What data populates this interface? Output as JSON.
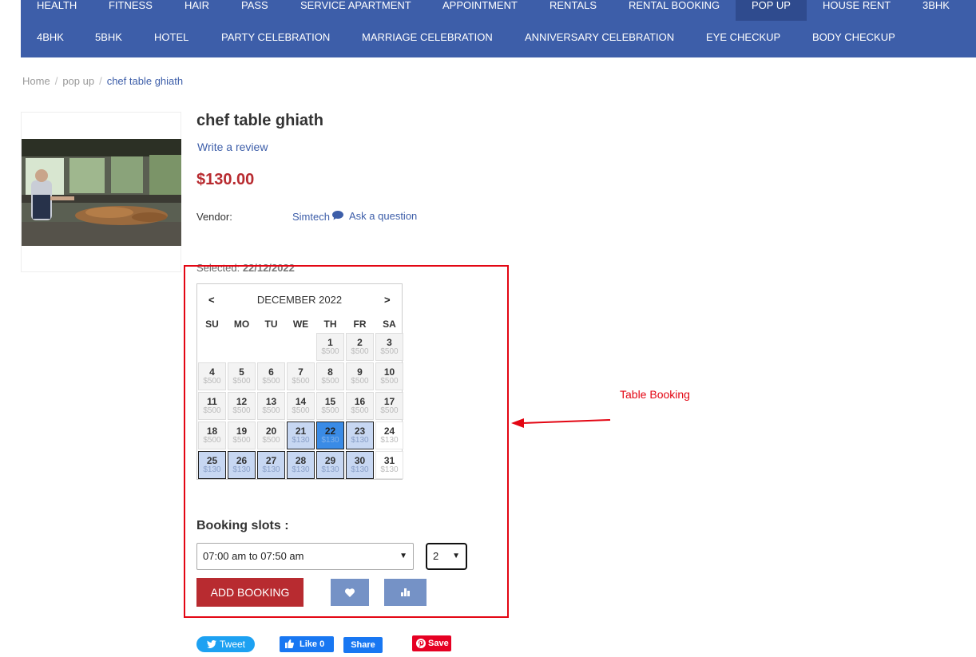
{
  "nav": {
    "row1": [
      "HEALTH",
      "FITNESS",
      "HAIR",
      "PASS",
      "SERVICE APARTMENT",
      "APPOINTMENT",
      "RENTALS",
      "RENTAL BOOKING",
      "POP UP",
      "HOUSE RENT",
      "3BHK"
    ],
    "row2": [
      "4BHK",
      "5BHK",
      "HOTEL",
      "PARTY CELEBRATION",
      "MARRIAGE CELEBRATION",
      "ANNIVERSARY CELEBRATION",
      "EYE CHECKUP",
      "BODY CHECKUP"
    ],
    "active": "POP UP"
  },
  "breadcrumb": {
    "home": "Home",
    "sep": "/",
    "category": "pop up",
    "current": "chef table ghiath"
  },
  "product": {
    "title": "chef table ghiath",
    "review_link": "Write a review",
    "price": "$130.00",
    "vendor_label": "Vendor:",
    "vendor_name": "Simtech",
    "ask_question": "Ask a question",
    "selected_label": "Selected:",
    "selected_date": "22/12/2022"
  },
  "calendar": {
    "prev": "<",
    "next": ">",
    "month": "DECEMBER 2022",
    "weekdays": [
      "SU",
      "MO",
      "TU",
      "WE",
      "TH",
      "FR",
      "SA"
    ],
    "days": [
      {
        "d": "1",
        "p": "$500",
        "s": "past"
      },
      {
        "d": "2",
        "p": "$500",
        "s": "past"
      },
      {
        "d": "3",
        "p": "$500",
        "s": "past"
      },
      {
        "d": "4",
        "p": "$500",
        "s": "past"
      },
      {
        "d": "5",
        "p": "$500",
        "s": "past"
      },
      {
        "d": "6",
        "p": "$500",
        "s": "past"
      },
      {
        "d": "7",
        "p": "$500",
        "s": "past"
      },
      {
        "d": "8",
        "p": "$500",
        "s": "past"
      },
      {
        "d": "9",
        "p": "$500",
        "s": "past"
      },
      {
        "d": "10",
        "p": "$500",
        "s": "past"
      },
      {
        "d": "11",
        "p": "$500",
        "s": "past"
      },
      {
        "d": "12",
        "p": "$500",
        "s": "past"
      },
      {
        "d": "13",
        "p": "$500",
        "s": "past"
      },
      {
        "d": "14",
        "p": "$500",
        "s": "past"
      },
      {
        "d": "15",
        "p": "$500",
        "s": "past"
      },
      {
        "d": "16",
        "p": "$500",
        "s": "past"
      },
      {
        "d": "17",
        "p": "$500",
        "s": "past"
      },
      {
        "d": "18",
        "p": "$500",
        "s": "past"
      },
      {
        "d": "19",
        "p": "$500",
        "s": "past"
      },
      {
        "d": "20",
        "p": "$500",
        "s": "past"
      },
      {
        "d": "21",
        "p": "$130",
        "s": "avail"
      },
      {
        "d": "22",
        "p": "$130",
        "s": "sel"
      },
      {
        "d": "23",
        "p": "$130",
        "s": "avail"
      },
      {
        "d": "24",
        "p": "$130",
        "s": "plain"
      },
      {
        "d": "25",
        "p": "$130",
        "s": "avail"
      },
      {
        "d": "26",
        "p": "$130",
        "s": "avail"
      },
      {
        "d": "27",
        "p": "$130",
        "s": "avail"
      },
      {
        "d": "28",
        "p": "$130",
        "s": "avail"
      },
      {
        "d": "29",
        "p": "$130",
        "s": "avail"
      },
      {
        "d": "30",
        "p": "$130",
        "s": "avail"
      },
      {
        "d": "31",
        "p": "$130",
        "s": "plain"
      }
    ]
  },
  "booking": {
    "slots_title": "Booking slots :",
    "slot_value": "07:00 am to 07:50 am",
    "qty_value": "2",
    "add_button": "ADD BOOKING",
    "wishlist_icon": "heart-icon",
    "compare_icon": "bar-chart-icon"
  },
  "annotation": {
    "label": "Table Booking",
    "color": "#e30613"
  },
  "social": {
    "tweet": "Tweet",
    "like": "Like 0",
    "share": "Share",
    "save": "Save"
  },
  "colors": {
    "nav_bg": "#3d5ea9",
    "price": "#b82b30",
    "selected_day": "#3a8be6",
    "available_day": "#c7d7f2"
  }
}
